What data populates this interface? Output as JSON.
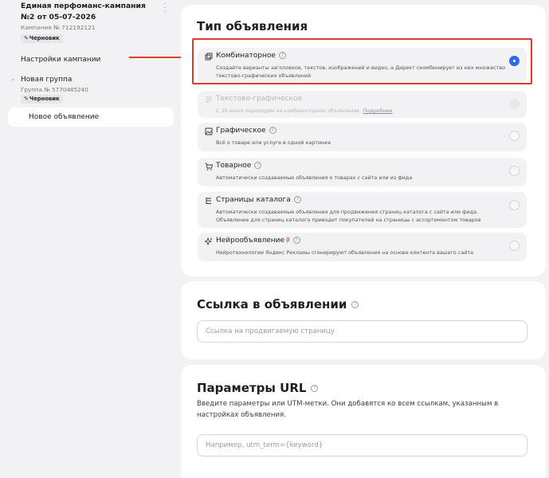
{
  "sidebar": {
    "campaign_title": "Единая перфоманс-кампания №2 от 05-07-2026",
    "campaign_number": "Кампания № 712192121",
    "campaign_status": "Черновик",
    "settings_link": "Настройки кампании",
    "group_title": "Новая группа",
    "group_number": "Группа № 5770485240",
    "group_status": "Черновик",
    "new_ad": "Новое объявление",
    "menu_icon": "kebab-icon",
    "pen_icon": "pencil-icon"
  },
  "ad_type": {
    "title": "Тип объявления",
    "options": [
      {
        "title": "Комбинаторное",
        "description": "Создайте варианты заголовков, текстов, изображений и видео, а Директ скомбинирует из них множество текстово-графических объявлений",
        "selected": true,
        "icon": "combinatorial-icon"
      },
      {
        "title": "Текстово-графическое",
        "description": "С 30 июня переходим на комбинаторное объявление.",
        "more_link": "Подробнее",
        "disabled": true,
        "icon": "text-graphic-icon"
      },
      {
        "title": "Графическое",
        "description": "Всё о товаре или услуге в одной картинке",
        "icon": "image-icon"
      },
      {
        "title": "Товарное",
        "description": "Автоматически создаваемые объявления о товарах с сайта или из фида",
        "icon": "cart-icon"
      },
      {
        "title": "Страницы каталога",
        "description": "Автоматически создаваемые объявления для продвижения страниц каталога с сайта или фида. Объявление для страниц каталога приводит покупателей на страницы с ассортиментом товаров",
        "icon": "catalog-tree-icon"
      },
      {
        "title": "Нейрообъявление",
        "beta": "β",
        "description": "Нейротехнологии Яндекс Рекламы сгенерируют объявления на основе контента вашего сайта",
        "icon": "sparkle-icon"
      }
    ]
  },
  "ad_link": {
    "title": "Ссылка в объявлении",
    "placeholder": "Ссылка на продвигаемую страницу",
    "value": ""
  },
  "url_params": {
    "title": "Параметры URL",
    "intro": "Введите параметры или UTM-метки. Они добавятся ко всем ссылкам, указанным в настройках объявления.",
    "placeholder": "Например, utm_term={keyword}",
    "value": ""
  },
  "colors": {
    "accent": "#2f6bf0",
    "annotation": "#e23b2c",
    "beta": "#e53935"
  }
}
